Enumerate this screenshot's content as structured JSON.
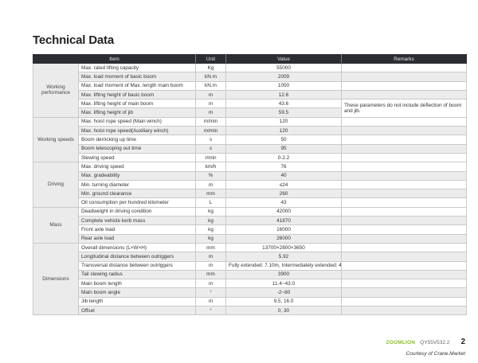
{
  "title": "Technical Data",
  "headers": {
    "item": "Item",
    "unit": "Unit",
    "value": "Value",
    "remarks": "Remarks"
  },
  "groups": [
    {
      "name": "Working performance",
      "rows": [
        {
          "item": "Max. rated lifting capacity",
          "unit": "Kg",
          "value": "55000"
        },
        {
          "item": "Max. load moment of basic boom",
          "unit": "kN.m",
          "value": "2009"
        },
        {
          "item": "Max. load moment of Max. length main boom",
          "unit": "kN.m",
          "value": "1050"
        },
        {
          "item": "Max. lifting height of basic boom",
          "unit": "m",
          "value": "12.6"
        },
        {
          "item": "Max. lifting height of main boom",
          "unit": "m",
          "value": "43.6"
        },
        {
          "item": "Max. lifting height of jib",
          "unit": "m",
          "value": "59.5"
        }
      ]
    },
    {
      "name": "Working speeds",
      "rows": [
        {
          "item": "Max. hoist rope speed (Main winch)",
          "unit": "m/min",
          "value": "120"
        },
        {
          "item": "Max. hoist rope speed(Auxiliary winch)",
          "unit": "m/min",
          "value": "120"
        },
        {
          "item": "Boom derricking up time",
          "unit": "s",
          "value": "50"
        },
        {
          "item": "Boom telescoping out time",
          "unit": "s",
          "value": "95"
        },
        {
          "item": "Slewing speed",
          "unit": "r/min",
          "value": "0-2.2"
        }
      ]
    },
    {
      "name": "Driving",
      "rows": [
        {
          "item": "Max. driving speed",
          "unit": "km/h",
          "value": "76"
        },
        {
          "item": "Max. gradeability",
          "unit": "%",
          "value": "40"
        },
        {
          "item": "Min. turning diameter",
          "unit": "m",
          "value": "≤24"
        },
        {
          "item": "Min. ground clearance",
          "unit": "mm",
          "value": "260"
        },
        {
          "item": "Oil consumption per hundred kilometer",
          "unit": "L",
          "value": "43"
        }
      ]
    },
    {
      "name": "Mass",
      "rows": [
        {
          "item": "Deadweight in driving condition",
          "unit": "kg",
          "value": "42000"
        },
        {
          "item": "Complete vehicle kerb mass",
          "unit": "kg",
          "value": "41870"
        },
        {
          "item": "Front axle load",
          "unit": "kg",
          "value": "16000"
        },
        {
          "item": "Rear axle load",
          "unit": "kg",
          "value": "26000"
        }
      ]
    },
    {
      "name": "Dimensions",
      "rows": [
        {
          "item": "Overall dimensions (L×W×H)",
          "unit": "mm",
          "value": "13700×2800×3650"
        },
        {
          "item": "Longitudinal distance between outriggers",
          "unit": "m",
          "value": "5.92"
        },
        {
          "item": "Transversal distance between outriggers",
          "unit": "m",
          "value": "Fully extended: 7.10m, Intermediately extended: 4.80m"
        },
        {
          "item": "Tail slewing radius",
          "unit": "mm",
          "value": "3900"
        },
        {
          "item": "Main boom length",
          "unit": "m",
          "value": "11.4~43.0"
        },
        {
          "item": "Main boom angle",
          "unit": "°",
          "value": "-2~80"
        },
        {
          "item": "Jib length",
          "unit": "m",
          "value": "9.5, 16.0"
        },
        {
          "item": "Offset",
          "unit": "°",
          "value": "0, 30"
        }
      ]
    }
  ],
  "remark": "These parameters do not include deflection of boom and jib.",
  "footer": {
    "brand": "ZOOMLION",
    "model": "QY55V532.2",
    "page": "2",
    "credit": "Courtesy of Crane.Market"
  }
}
